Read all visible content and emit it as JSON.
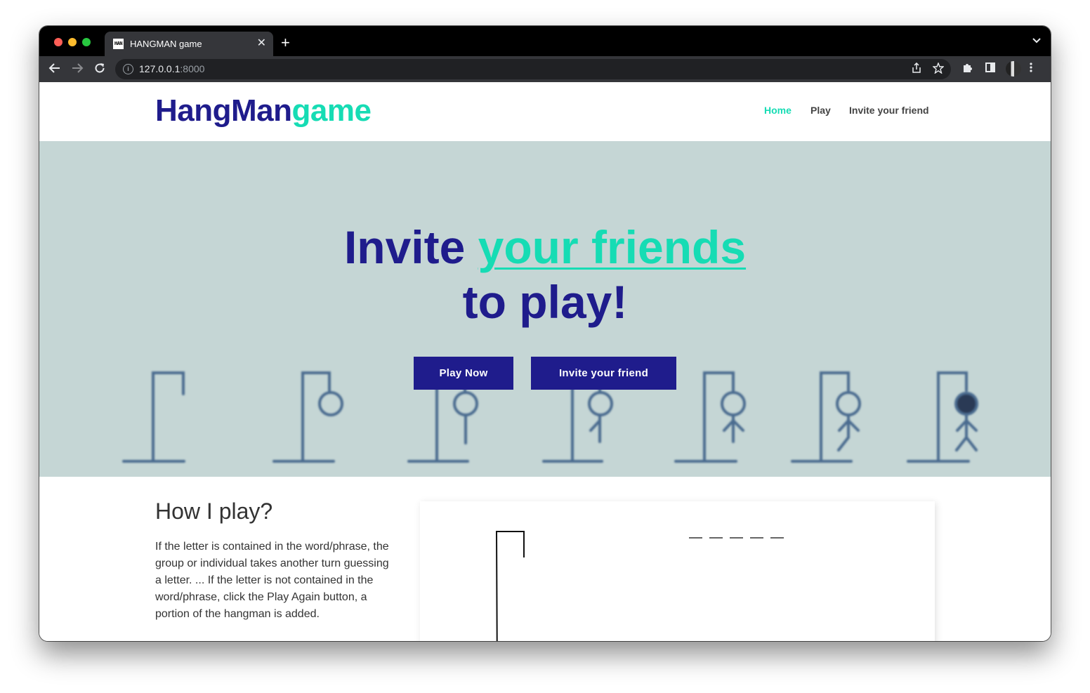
{
  "browser": {
    "tab_title": "HANGMAN game",
    "tab_favicon_text": "HAN",
    "close_glyph": "✕",
    "new_tab_glyph": "+",
    "tab_search_glyph": "⌄",
    "url_host": "127.0.0.1",
    "url_port": ":8000",
    "icons": [
      "back-icon",
      "forward-icon",
      "reload-icon",
      "info-icon",
      "share-icon",
      "star-icon",
      "extensions-icon",
      "side-panel-icon",
      "profile-avatar",
      "menu-icon"
    ]
  },
  "site": {
    "logo_part1": "HangMan",
    "logo_part2": "game",
    "nav": {
      "home": "Home",
      "play": "Play",
      "invite": "Invite your friend"
    },
    "colors": {
      "primary": "#1f1c8c",
      "accent": "#16dcb4",
      "hero_bg": "#c5d6d5"
    }
  },
  "hero": {
    "title_part1": "Invite ",
    "title_accent": "your friends",
    "title_part2": "to play!",
    "play_button": "Play Now",
    "invite_button": "Invite your friend"
  },
  "how_to_play": {
    "heading": "How I play?",
    "text": "If the letter is contained in the word/phrase, the group or individual takes another turn guessing a letter. ... If the letter is not contained in the word/phrase, click the Play Again button, a portion of the hangman is added."
  },
  "game_board": {
    "hidden_word_blanks": 5
  }
}
